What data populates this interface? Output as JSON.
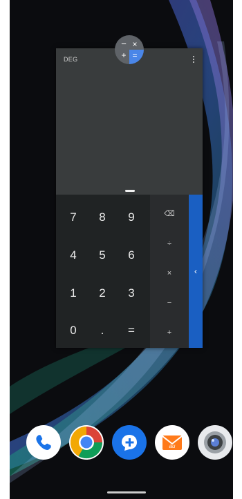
{
  "recents_card": {
    "angle_mode": "DEG",
    "keypad": {
      "digits": [
        "7",
        "8",
        "9",
        "4",
        "5",
        "6",
        "1",
        "2",
        "3",
        "0",
        ".",
        "="
      ],
      "operators": [
        "⌫",
        "÷",
        "×",
        "−",
        "+"
      ]
    }
  },
  "app_icon": {
    "name": "calculator-icon",
    "glyphs": [
      "−",
      "×",
      "+",
      "="
    ]
  },
  "dock": {
    "apps": [
      "phone-icon",
      "chrome-icon",
      "messages-icon",
      "au-mail-icon",
      "camera-icon"
    ]
  },
  "colors": {
    "accent_blue": "#1a5fc2",
    "display_bg": "#393c3d",
    "pad_bg": "#202324"
  }
}
